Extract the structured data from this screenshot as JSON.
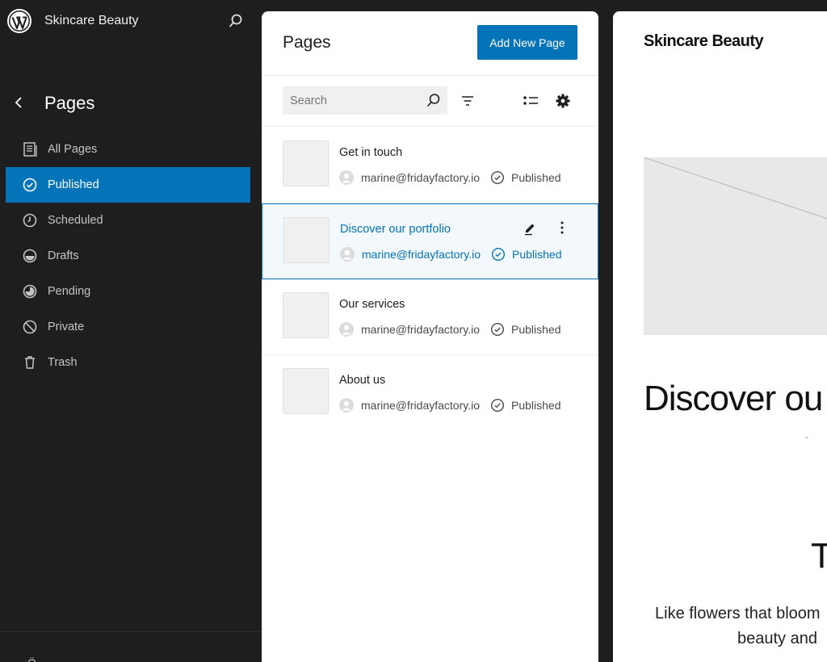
{
  "sidebar": {
    "site_name": "Skincare Beauty",
    "title": "Pages",
    "items": [
      {
        "label": "All Pages",
        "icon": "pages-icon",
        "active": false
      },
      {
        "label": "Published",
        "icon": "published-icon",
        "active": true
      },
      {
        "label": "Scheduled",
        "icon": "scheduled-icon",
        "active": false
      },
      {
        "label": "Drafts",
        "icon": "drafts-icon",
        "active": false
      },
      {
        "label": "Pending",
        "icon": "pending-icon",
        "active": false
      },
      {
        "label": "Private",
        "icon": "private-icon",
        "active": false
      },
      {
        "label": "Trash",
        "icon": "trash-icon",
        "active": false
      }
    ],
    "footer_label": "Ö"
  },
  "pages_panel": {
    "title": "Pages",
    "add_button": "Add New Page",
    "search": {
      "placeholder": "Search",
      "value": ""
    },
    "rows": [
      {
        "title": "Get in touch",
        "author": "marine@fridayfactory.io",
        "status": "Published",
        "selected": false
      },
      {
        "title": "Discover our portfolio",
        "author": "marine@fridayfactory.io",
        "status": "Published",
        "selected": true
      },
      {
        "title": "Our services",
        "author": "marine@fridayfactory.io",
        "status": "Published",
        "selected": false
      },
      {
        "title": "About us",
        "author": "marine@fridayfactory.io",
        "status": "Published",
        "selected": false
      }
    ]
  },
  "preview": {
    "site_title": "Skincare Beauty",
    "heading": "Discover ou",
    "dash": "-",
    "big_letter": "T",
    "text_line1": "Like flowers that bloom",
    "text_line2": "beauty and"
  },
  "colors": {
    "accent": "#0473b7",
    "sidebar_bg": "#1e1e1e"
  }
}
